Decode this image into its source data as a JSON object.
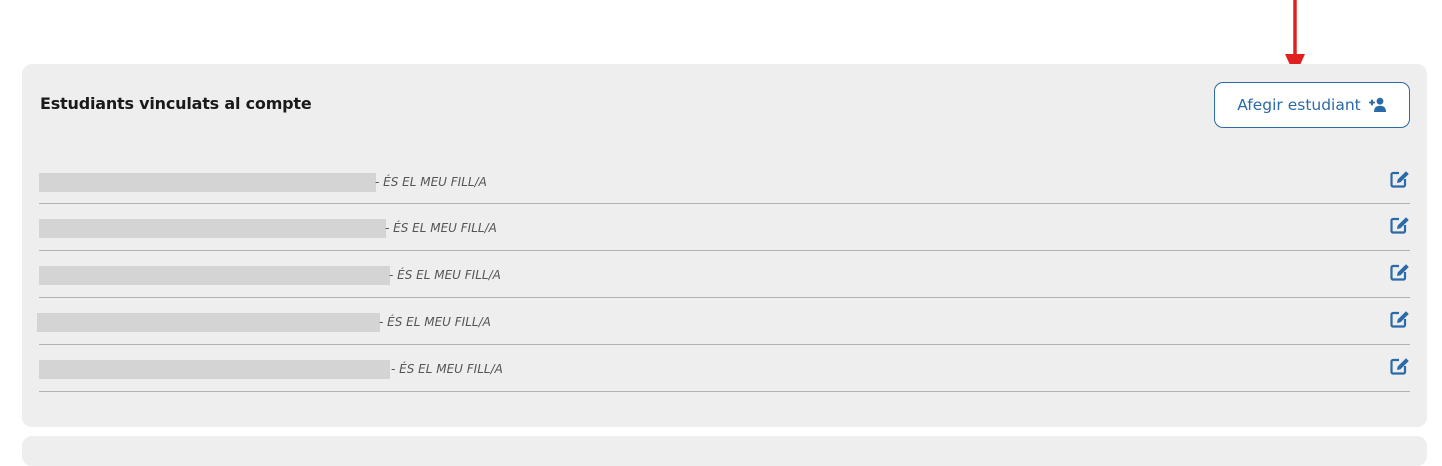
{
  "section": {
    "title": "Estudiants vinculats al compte",
    "add_button_label": "Afegir estudiant",
    "add_button_icon": "add-user-icon"
  },
  "students": [
    {
      "name": "",
      "relation": "- ÉS EL MEU FILL/A"
    },
    {
      "name": "",
      "relation": "- ÉS EL MEU FILL/A"
    },
    {
      "name": "",
      "relation": "- ÉS EL MEU FILL/A"
    },
    {
      "name": "",
      "relation": "- ÉS EL MEU FILL/A"
    },
    {
      "name": "",
      "relation": "- ÉS EL MEU FILL/A"
    }
  ],
  "colors": {
    "accent": "#2a6aa8",
    "annotation_arrow": "#e02020",
    "card_background": "#eeeeee",
    "redaction": "#d4d4d4"
  }
}
